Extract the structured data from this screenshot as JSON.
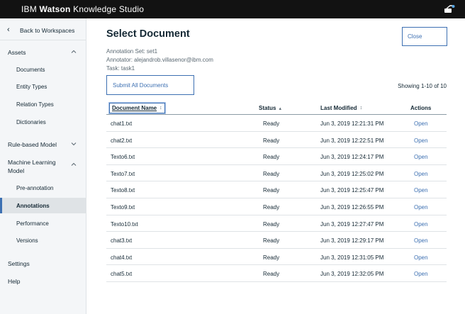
{
  "header": {
    "brand_ibm": "IBM",
    "brand_watson": "Watson",
    "brand_rest": "Knowledge Studio",
    "user_icon": "user-switch-icon"
  },
  "sidebar": {
    "back_label": "Back to Workspaces",
    "sections": {
      "assets": {
        "label": "Assets",
        "items": [
          "Documents",
          "Entity Types",
          "Relation Types",
          "Dictionaries"
        ]
      },
      "rule_based": {
        "label": "Rule-based Model"
      },
      "ml_model": {
        "label_line1": "Machine Learning",
        "label_line2": "Model",
        "items": [
          "Pre-annotation",
          "Annotations",
          "Performance",
          "Versions"
        ],
        "active_item": "Annotations"
      },
      "settings": {
        "label": "Settings"
      },
      "help": {
        "label": "Help"
      }
    }
  },
  "main": {
    "title": "Select Document",
    "annotation_set": "Annotation Set: set1",
    "annotator": "Annotator: alejandrob.villasenor@ibm.com",
    "task": "Task: task1",
    "close_label": "Close",
    "submit_label": "Submit All Documents",
    "showing": "Showing 1-10 of 10",
    "columns": {
      "document_name": "Document Name",
      "status": "Status",
      "last_modified": "Last Modified",
      "actions": "Actions"
    },
    "rows": [
      {
        "name": "chat1.txt",
        "status": "Ready",
        "modified": "Jun 3, 2019 12:21:31 PM",
        "action": "Open"
      },
      {
        "name": "chat2.txt",
        "status": "Ready",
        "modified": "Jun 3, 2019 12:22:51 PM",
        "action": "Open"
      },
      {
        "name": "Texto6.txt",
        "status": "Ready",
        "modified": "Jun 3, 2019 12:24:17 PM",
        "action": "Open"
      },
      {
        "name": "Texto7.txt",
        "status": "Ready",
        "modified": "Jun 3, 2019 12:25:02 PM",
        "action": "Open"
      },
      {
        "name": "Texto8.txt",
        "status": "Ready",
        "modified": "Jun 3, 2019 12:25:47 PM",
        "action": "Open"
      },
      {
        "name": "Texto9.txt",
        "status": "Ready",
        "modified": "Jun 3, 2019 12:26:55 PM",
        "action": "Open"
      },
      {
        "name": "Texto10.txt",
        "status": "Ready",
        "modified": "Jun 3, 2019 12:27:47 PM",
        "action": "Open"
      },
      {
        "name": "chat3.txt",
        "status": "Ready",
        "modified": "Jun 3, 2019 12:29:17 PM",
        "action": "Open"
      },
      {
        "name": "chat4.txt",
        "status": "Ready",
        "modified": "Jun 3, 2019 12:31:05 PM",
        "action": "Open"
      },
      {
        "name": "chat5.txt",
        "status": "Ready",
        "modified": "Jun 3, 2019 12:32:05 PM",
        "action": "Open"
      }
    ]
  },
  "colors": {
    "topbar": "#121212",
    "accent": "#3d70b2",
    "sidebar_bg": "#f4f6f8",
    "text": "#152935"
  }
}
